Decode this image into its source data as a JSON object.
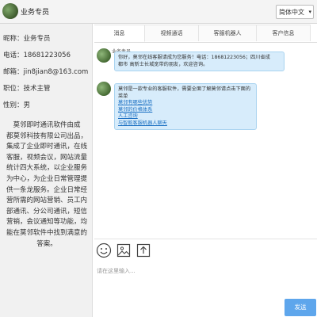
{
  "header": {
    "agent_title": "业务专员",
    "language": "简体中文"
  },
  "profile": {
    "nickname": "昵称：业务专员",
    "phone": "电话：18681223056",
    "email": "邮箱：jin8jian8@163.com",
    "position": "职位：技术主管",
    "gender": "性别：男",
    "intro_lines": [
      "莫邻即时通讯软件由成",
      "都莫邻科技有限公司出品，",
      "集成了企业即时通讯，在线",
      "客服，视频会议，网站流量",
      "统计四大系统，以企业服务",
      "为中心，为企业日常管理提",
      "供一条龙服务。企业日常经",
      "营所需的网站营销、员工内",
      "部通讯、分公司通讯，短信",
      "营销，会议通知等功能，均",
      "能在莫邻软件中找到满意的",
      "答案。"
    ]
  },
  "tabs": [
    "消息",
    "视频通话",
    "客服机器人",
    "客户信息"
  ],
  "messages": [
    {
      "sender": "业务专员",
      "text_lines": [
        "你好，莫邻在线客服请成为您服务！电话：18681223056；四川省成",
        "都市 高新士长城宽带的朋友，欢迎咨询。"
      ]
    },
    {
      "sender": "",
      "intro": "莫邻是一款专业的客服软件，需要全面了解莫邻请点击下面的菜单",
      "links": [
        "莫邻有哪些优势",
        "莫邻的价格体系",
        "人工咨询",
        "与智能客服机器人聊天"
      ]
    }
  ],
  "input": {
    "placeholder": "请在这里输入...",
    "send_label": "发送"
  },
  "icons": {
    "emoji": "emoji-icon",
    "image": "image-icon",
    "file": "file-upload-icon"
  },
  "colors": {
    "bubble_bg": "#d7ecfb",
    "link": "#1a6fc2",
    "send_button": "#5ea6ec"
  }
}
